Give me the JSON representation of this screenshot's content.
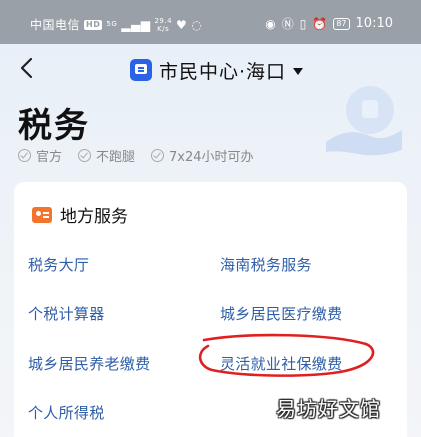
{
  "status_bar": {
    "carrier": "中国电信",
    "hd": "HD",
    "signal": "5G",
    "net_speed_value": "29.4",
    "net_speed_unit": "K/s",
    "battery": "87",
    "time": "10:10"
  },
  "header": {
    "title": "市民中心·海口"
  },
  "page": {
    "title": "税务",
    "features": [
      "官方",
      "不跑腿",
      "7x24小时可办"
    ]
  },
  "section": {
    "title": "地方服务",
    "services": [
      "税务大厅",
      "海南税务服务",
      "个税计算器",
      "城乡居民医疗缴费",
      "城乡居民养老缴费",
      "灵活就业社保缴费",
      "个人所得税"
    ]
  },
  "watermark": "易坊好文馆",
  "colors": {
    "accent_blue": "#2a63e6",
    "link_blue": "#2f5ea8",
    "orange": "#f2742d",
    "annotation_red": "#e02020"
  }
}
